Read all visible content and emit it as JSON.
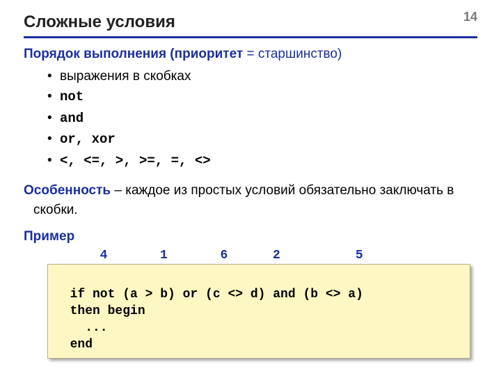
{
  "page_number": "14",
  "title": "Сложные условия",
  "order_heading": {
    "bold": "Порядок выполнения (приоритет",
    "tail": " = старшинство)"
  },
  "bullets": [
    {
      "text": "выражения в скобках",
      "mono": false
    },
    {
      "text": "not",
      "mono": true
    },
    {
      "text": "and",
      "mono": true
    },
    {
      "text": "or, xor",
      "mono": true
    },
    {
      "text": "<, <=, >, >=, =, <>",
      "mono": true
    }
  ],
  "feature": {
    "lead": "Особенность",
    "rest": " – каждое из простых условий обязательно заключать в скобки."
  },
  "example_label": "Пример",
  "order_numbers": "       4       1       6      2          5",
  "code_lines": [
    "  if not (a > b) or (c <> d) and (b <> a)",
    "  then begin",
    "    ...",
    "  end"
  ]
}
